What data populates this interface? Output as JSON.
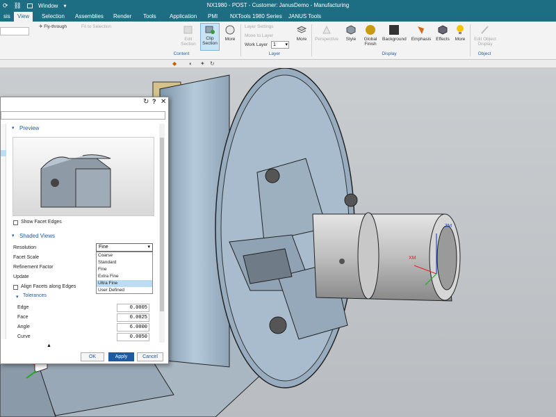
{
  "titlebar": {
    "window_label": "Window",
    "title": "NX1980 - POST - Customer: JanusDemo - Manufacturing"
  },
  "tabs": [
    {
      "label": "sis"
    },
    {
      "label": "View"
    },
    {
      "label": "Selection"
    },
    {
      "label": "Assemblies"
    },
    {
      "label": "Render"
    },
    {
      "label": "Tools"
    },
    {
      "label": "Application"
    },
    {
      "label": "PMI"
    },
    {
      "label": "NXTools 1980 Series"
    },
    {
      "label": "JANUS Tools"
    }
  ],
  "ribbon": {
    "fly_through": "Fly-through",
    "fit_to_selection": "Fit to Selection",
    "edit_section": "Edit Section",
    "clip_section": "Clip Section",
    "more1": "More",
    "layer_settings": "Layer Settings",
    "move_to_layer": "Move to Layer",
    "work_layer_label": "Work Layer",
    "work_layer_value": "1",
    "more2": "More",
    "perspective": "Perspective",
    "style": "Style",
    "global_finish": "Global Finish",
    "background": "Background",
    "emphasis": "Emphasis",
    "effects": "Effects",
    "more3": "More",
    "edit_object_display": "Edit Object Display",
    "group_content": "Content",
    "group_layer": "Layer",
    "group_display": "Display",
    "group_object": "Object"
  },
  "dialog": {
    "preview_title": "Preview",
    "show_facet_edges": "Show Facet Edges",
    "shaded_views_title": "Shaded Views",
    "resolution_label": "Resolution",
    "resolution_value": "Fine",
    "facet_scale_label": "Facet Scale",
    "refinement_label": "Refinement Factor",
    "update_label": "Update",
    "align_facets_label": "Align Facets along Edges",
    "tolerances_title": "Tolerances",
    "edge_label": "Edge",
    "edge_value": "0.0005",
    "face_label": "Face",
    "face_value": "0.0025",
    "angle_label": "Angle",
    "angle_value": "6.0000",
    "curve_label": "Curve",
    "curve_value": "0.0050",
    "ok": "OK",
    "apply": "Apply",
    "cancel": "Cancel",
    "resolution_options": [
      "Coarse",
      "Standard",
      "Fine",
      "Extra Fine",
      "Ultra Fine",
      "User Defined"
    ],
    "highlighted_option": "Ultra Fine"
  },
  "viewport": {
    "zm_label": "ZM",
    "xm_label": "XM"
  },
  "colors": {
    "title_bg": "#1d6d83",
    "accent": "#1d5aa0",
    "part_blue": "#b8cddc",
    "highlight": "#bcdcf3"
  }
}
